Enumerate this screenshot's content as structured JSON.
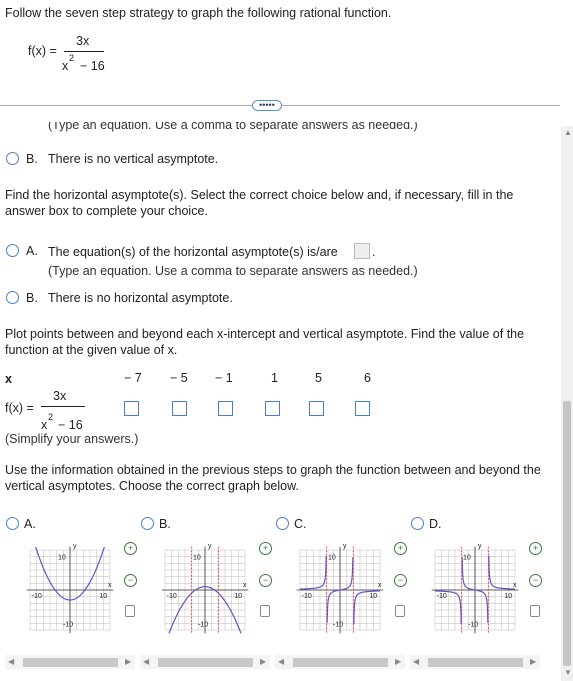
{
  "header": {
    "instruction": "Follow the seven step strategy to graph the following rational function.",
    "func_lhs": "f(x) =",
    "func_num": "3x",
    "func_den_x": "x",
    "func_den_exp": "2",
    "func_den_rest": "− 16"
  },
  "more_button": "•••••",
  "vertical_section": {
    "hint_cut": "(Type an equation. Use a comma to separate answers as needed.)",
    "option_b": "B.",
    "option_b_text": "There is no vertical asymptote."
  },
  "horizontal_section": {
    "prompt": "Find the horizontal asymptote(s). Select the correct choice below and, if necessary, fill in the answer box to complete your choice.",
    "option_a": "A.",
    "option_a_text": "The equation(s) of the horizontal asymptote(s) is/are",
    "option_a_hint": "(Type an equation. Use a comma to separate answers as needed.)",
    "option_b": "B.",
    "option_b_text": "There is no horizontal asymptote."
  },
  "plot_section": {
    "prompt": "Plot points between and beyond each x-intercept and vertical asymptote. Find the value of the function at the given value of x.",
    "x_label": "x",
    "x_values": [
      "− 7",
      "− 5",
      "− 1",
      "1",
      "5",
      "6"
    ],
    "fx_lhs": "f(x) =",
    "fx_num": "3x",
    "fx_den_x": "x",
    "fx_den_exp": "2",
    "fx_den_rest": "− 16",
    "simplify": "(Simplify your answers.)"
  },
  "graph_section": {
    "prompt": "Use the information obtained in the previous steps to graph the function between and beyond the vertical asymptotes. Choose the correct graph below.",
    "options": [
      {
        "label": "A."
      },
      {
        "label": "B."
      },
      {
        "label": "C."
      },
      {
        "label": "D."
      }
    ],
    "axis_y": "y",
    "axis_x": "x",
    "tick_pos": "10",
    "tick_neg": "-10",
    "colors": {
      "curve": "#6a4fc8",
      "asymptote": "#e23b3b",
      "grid": "#bbbbbb"
    }
  }
}
